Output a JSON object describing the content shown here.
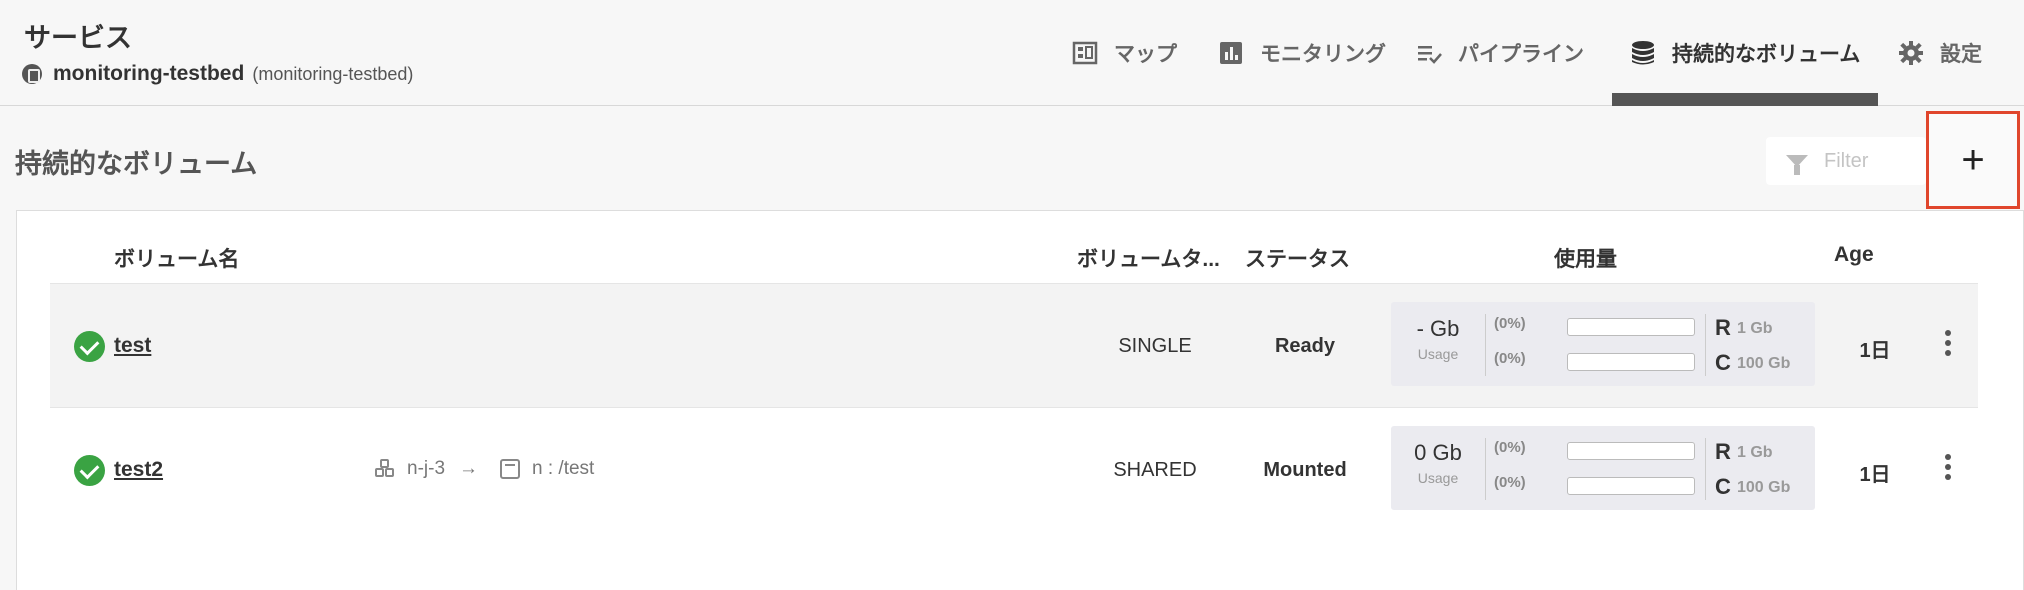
{
  "header": {
    "service_title": "サービス",
    "service_name": "monitoring-testbed",
    "service_namespace": "(monitoring-testbed)",
    "nav": [
      {
        "label": "マップ",
        "icon": "map-icon"
      },
      {
        "label": "モニタリング",
        "icon": "chart-icon"
      },
      {
        "label": "パイプライン",
        "icon": "pipeline-icon"
      },
      {
        "label": "持続的なボリューム",
        "icon": "database-icon",
        "active": true
      },
      {
        "label": "設定",
        "icon": "gear-icon"
      }
    ]
  },
  "toolbar": {
    "page_title": "持続的なボリューム",
    "filter_placeholder": "Filter",
    "add_label": "+"
  },
  "table": {
    "columns": [
      "ボリューム名",
      "ボリュームタ...",
      "ステータス",
      "使用量",
      "Age"
    ],
    "rows": [
      {
        "name": "test",
        "status_icon": "check-circle-icon",
        "type": "SINGLE",
        "status": "Ready",
        "usage": {
          "amount": "- Gb",
          "amount_label": "Usage",
          "r_pct": "(0%)",
          "c_pct": "(0%)",
          "r_fill": 0,
          "c_fill": 0,
          "r_label": "R",
          "r_value": "1 Gb",
          "c_label": "C",
          "c_value": "100 Gb"
        },
        "age": "1日"
      },
      {
        "name": "test2",
        "status_icon": "check-circle-icon",
        "node": "n-j-3",
        "arrow": "→",
        "mount": "n : /test",
        "type": "SHARED",
        "status": "Mounted",
        "usage": {
          "amount": "0 Gb",
          "amount_label": "Usage",
          "r_pct": "(0%)",
          "c_pct": "(0%)",
          "r_fill": 0,
          "c_fill": 0,
          "r_label": "R",
          "r_value": "1 Gb",
          "c_label": "C",
          "c_value": "100 Gb"
        },
        "age": "1日"
      }
    ]
  }
}
